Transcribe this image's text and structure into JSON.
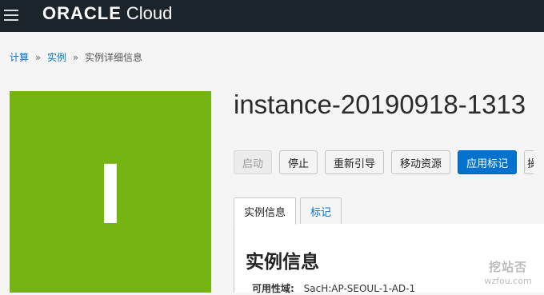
{
  "header": {
    "menu_icon": "hamburger-menu-icon",
    "logo_oracle": "ORACLE",
    "logo_cloud": "Cloud"
  },
  "breadcrumb": {
    "items": [
      {
        "label": "计算"
      },
      {
        "label": "实例"
      }
    ],
    "separator": "»",
    "current": "实例详细信息"
  },
  "instance": {
    "avatar_letter": "I",
    "avatar_color": "#76b414",
    "title": "instance-20190918-1313"
  },
  "actions": {
    "start": "启动",
    "stop": "停止",
    "reboot": "重新引导",
    "move_resource": "移动资源",
    "apply_tags": "应用标记",
    "more": "操"
  },
  "tabs": {
    "info": "实例信息",
    "tags": "标记"
  },
  "panel": {
    "title": "实例信息",
    "availability_domain_label": "可用性域:",
    "availability_domain_value": "SacH:AP-SEOUL-1-AD-1"
  },
  "watermark": {
    "top": "挖站否",
    "bottom": "wzfou.com"
  },
  "colors": {
    "topbar": "#1c242b",
    "link": "#0572ce",
    "primary_button": "#0572ce"
  }
}
